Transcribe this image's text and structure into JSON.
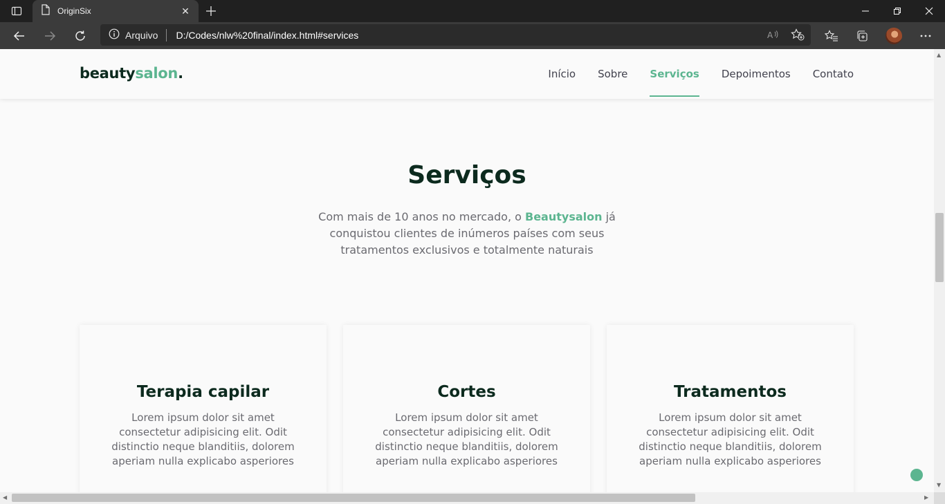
{
  "browser": {
    "tab_title": "OriginSix",
    "tab_close": "✕",
    "new_tab": "+",
    "site_info_label": "Arquivo",
    "url": "D:/Codes/nlw%20final/index.html#services"
  },
  "site": {
    "logo_main": "beauty",
    "logo_accent": "salon",
    "logo_dot": ".",
    "menu": [
      {
        "label": "Início",
        "active": false
      },
      {
        "label": "Sobre",
        "active": false
      },
      {
        "label": "Serviços",
        "active": true
      },
      {
        "label": "Depoimentos",
        "active": false
      },
      {
        "label": "Contato",
        "active": false
      }
    ],
    "services": {
      "title": "Serviços",
      "subtitle_before": "Com mais de 10 anos no mercado, o ",
      "subtitle_brand": "Beautysalon",
      "subtitle_after": " já conquistou clientes de inúmeros países com seus tratamentos exclusivos e totalmente naturais",
      "cards": [
        {
          "title": "Terapia capilar",
          "text": "Lorem ipsum dolor sit amet consectetur adipisicing elit. Odit distinctio neque blanditiis, dolorem aperiam nulla explicabo asperiores"
        },
        {
          "title": "Cortes",
          "text": "Lorem ipsum dolor sit amet consectetur adipisicing elit. Odit distinctio neque blanditiis, dolorem aperiam nulla explicabo asperiores"
        },
        {
          "title": "Tratamentos",
          "text": "Lorem ipsum dolor sit amet consectetur adipisicing elit. Odit distinctio neque blanditiis, dolorem aperiam nulla explicabo asperiores"
        }
      ]
    }
  },
  "colors": {
    "accent": "#5cb590",
    "heading": "#0c2a1e",
    "body_text": "#6a6a70",
    "background": "#fafafa"
  },
  "icons": {
    "tab_actions": "tab-actions-icon",
    "page": "page-icon",
    "back": "back-arrow-icon",
    "forward": "forward-arrow-icon",
    "reload": "reload-icon",
    "info": "info-icon",
    "read_aloud": "read-aloud-icon",
    "add_favorite": "add-favorite-icon",
    "favorites": "favorites-icon",
    "collections": "collections-icon",
    "more": "more-icon"
  }
}
